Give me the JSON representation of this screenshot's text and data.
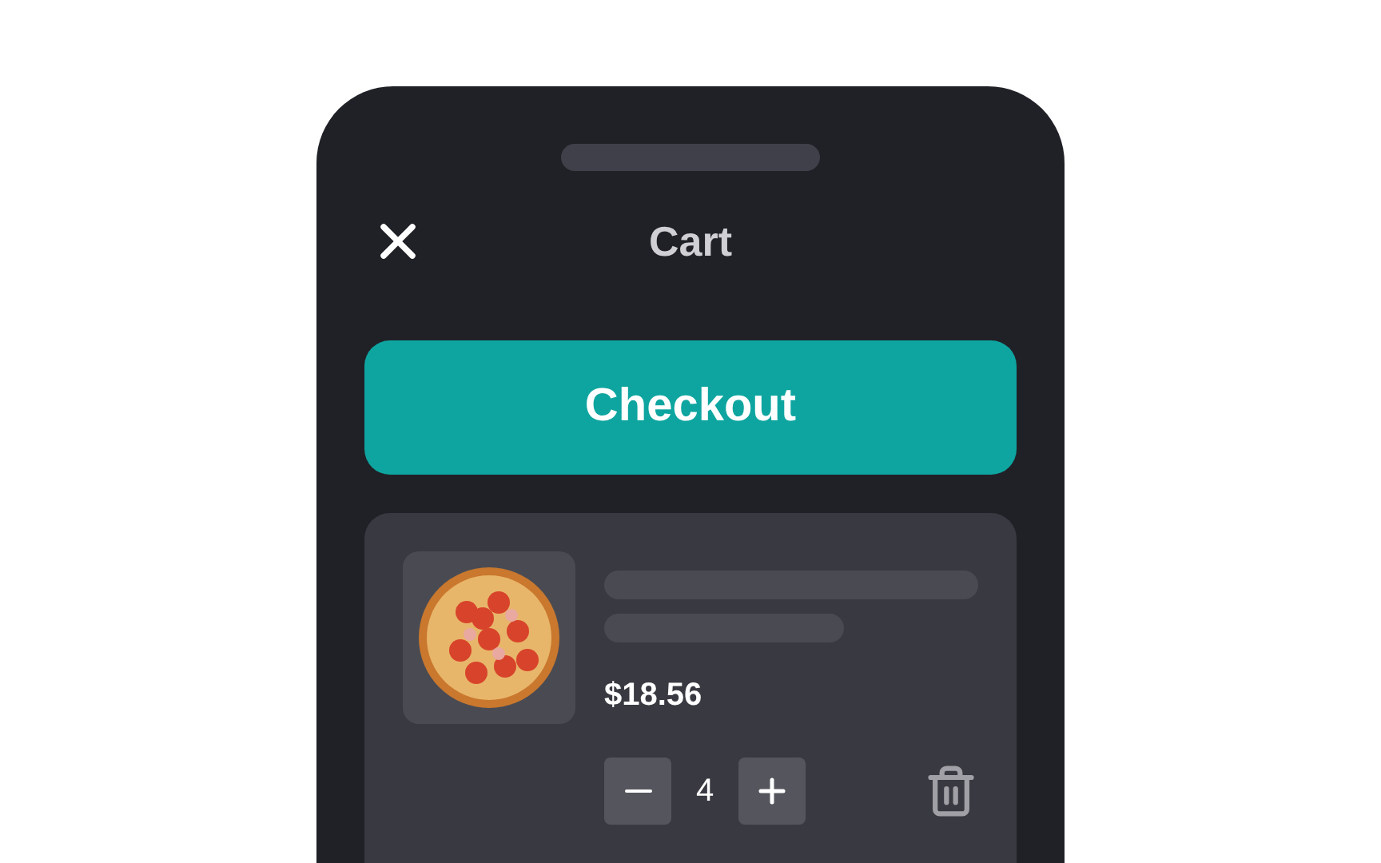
{
  "header": {
    "title": "Cart"
  },
  "checkout_button": {
    "label": "Checkout"
  },
  "cart_items": [
    {
      "price": "$18.56",
      "quantity": "4"
    }
  ]
}
